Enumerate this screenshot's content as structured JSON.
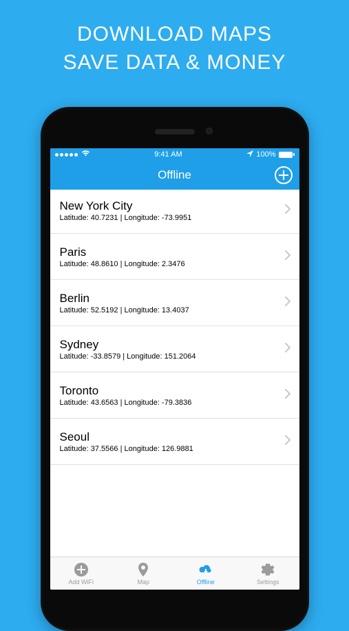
{
  "promo": {
    "line1": "DOWNLOAD MAPS",
    "line2": "SAVE DATA & MONEY"
  },
  "statusBar": {
    "time": "9:41 AM",
    "batteryPercent": "100%"
  },
  "navBar": {
    "title": "Offline"
  },
  "cities": [
    {
      "name": "New York City",
      "coords": "Latitude: 40.7231 | Longitude: -73.9951"
    },
    {
      "name": "Paris",
      "coords": "Latitude: 48.8610 | Longitude: 2.3476"
    },
    {
      "name": "Berlin",
      "coords": "Latitude: 52.5192 | Longitude: 13.4037"
    },
    {
      "name": "Sydney",
      "coords": "Latitude: -33.8579 | Longitude: 151.2064"
    },
    {
      "name": "Toronto",
      "coords": "Latitude: 43.6563 | Longitude: -79.3836"
    },
    {
      "name": "Seoul",
      "coords": "Latitude: 37.5566 | Longitude: 126.9881"
    }
  ],
  "tabs": [
    {
      "label": "Add WiFi",
      "icon": "plus-circle-icon",
      "active": false
    },
    {
      "label": "Map",
      "icon": "map-pin-icon",
      "active": false
    },
    {
      "label": "Offline",
      "icon": "cloud-download-icon",
      "active": true
    },
    {
      "label": "Settings",
      "icon": "gear-icon",
      "active": false
    }
  ],
  "colors": {
    "accent": "#1E9FE8",
    "background": "#2DACF0",
    "inactive": "#9B9B9B"
  }
}
